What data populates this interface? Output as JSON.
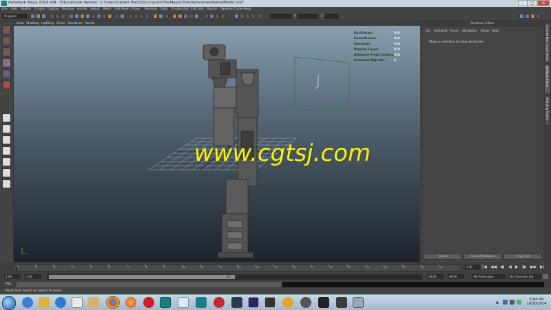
{
  "window": {
    "title": "Autodesk Maya 2014 x64 - Educational Version: C:\\Users\\Spider Man\\Documents\\TheMayer\\Tutorial\\scenes\\RobotModel.mb*"
  },
  "menubar": [
    "File",
    "Edit",
    "Modify",
    "Create",
    "Display",
    "Window",
    "Assets",
    "Select",
    "Mesh",
    "Edit Mesh",
    "Proxy",
    "Normals",
    "Color",
    "Create UVs",
    "Edit UVs",
    "Muscle",
    "Pipeline Cache",
    "Help"
  ],
  "statusline": {
    "menuset": "Polygons",
    "field_x": "",
    "field_y": "",
    "field_z": ""
  },
  "panel_menu": [
    "View",
    "Shading",
    "Lighting",
    "Show",
    "Renderer",
    "Panels"
  ],
  "hud": [
    {
      "label": "Backfaces:",
      "value": "N/A"
    },
    {
      "label": "Smoothness:",
      "value": "N/A"
    },
    {
      "label": "Instance:",
      "value": "N/A"
    },
    {
      "label": "Display Layer:",
      "value": "N/A"
    },
    {
      "label": "Distance From Camera:",
      "value": "N/A"
    },
    {
      "label": "Selected Objects:",
      "value": "0"
    }
  ],
  "watermark": "www.cgtsj.com",
  "viewport_footer": "",
  "attribute_editor": {
    "title": "Attribute Editor",
    "menu": [
      "List",
      "Selected",
      "Focus",
      "Attributes",
      "Show",
      "Help"
    ],
    "message": "Make a selection to view attributes",
    "buttons": [
      "Select",
      "Load Attributes",
      "Copy Tab"
    ]
  },
  "side_tabs": [
    "Channel Box / Layer Editor",
    "Attribute Editor",
    "Modeling Toolkit"
  ],
  "timeline": {
    "ticks": [
      "1",
      "2",
      "3",
      "4",
      "5",
      "6",
      "7",
      "8",
      "9",
      "10",
      "11",
      "12",
      "13",
      "14",
      "15",
      "16",
      "17",
      "18",
      "19",
      "20",
      "21",
      "22",
      "23",
      "24"
    ],
    "current": "1.00"
  },
  "range": {
    "start": "1.00",
    "inner_start": "1.00",
    "slider_label": "24",
    "end": "24.00",
    "outer_end": "48.00",
    "anim_layer": "No Anim Layer",
    "char_set": "No Character Set"
  },
  "cmdline": {
    "label": "MEL"
  },
  "helpline": "Move Tool: Select an object to move.",
  "taskbar": {
    "time": "5:04 PM",
    "date": "10/30/2014"
  }
}
